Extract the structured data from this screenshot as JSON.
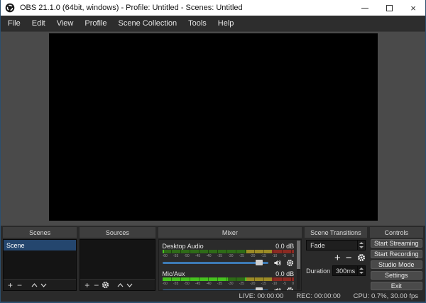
{
  "window": {
    "title": "OBS 21.1.0 (64bit, windows) - Profile: Untitled - Scenes: Untitled",
    "close_glyph": "×"
  },
  "menubar": {
    "items": [
      "File",
      "Edit",
      "View",
      "Profile",
      "Scene Collection",
      "Tools",
      "Help"
    ]
  },
  "scenes": {
    "title": "Scenes",
    "items": [
      {
        "label": "Scene",
        "selected": true
      }
    ],
    "toolbar": {
      "add": "+",
      "remove": "−"
    }
  },
  "sources": {
    "title": "Sources",
    "items": [],
    "toolbar": {
      "add": "+",
      "remove": "−"
    }
  },
  "mixer": {
    "title": "Mixer",
    "ticks": [
      "-60",
      "-55",
      "-50",
      "-45",
      "-40",
      "-35",
      "-30",
      "-25",
      "-20",
      "-15",
      "-10",
      "-5",
      "0"
    ],
    "channels": [
      {
        "name": "Desktop Audio",
        "level_db": "0.0 dB"
      },
      {
        "name": "Mic/Aux",
        "level_db": "0.0 dB"
      }
    ]
  },
  "scene_transitions": {
    "title": "Scene Transitions",
    "transition": "Fade",
    "add": "+",
    "remove": "−",
    "duration_label": "Duration",
    "duration_value": "300ms"
  },
  "controls": {
    "title": "Controls",
    "buttons": [
      "Start Streaming",
      "Start Recording",
      "Studio Mode",
      "Settings",
      "Exit"
    ]
  },
  "statusbar": {
    "live": "LIVE: 00:00:00",
    "rec": "REC: 00:00:00",
    "cpu": "CPU: 0.7%, 30.00 fps"
  },
  "colors": {
    "accent_border": "#2c4f6e",
    "selected_row": "#24466e",
    "slider_blue": "#3d7ab5",
    "meter_green_bright": "#46c31f",
    "meter_green_dim": "#2e6b17",
    "meter_yellow_dim": "#9c8b26",
    "meter_red_dim": "#8a2a22",
    "button_bg": "#4a4a4a"
  }
}
